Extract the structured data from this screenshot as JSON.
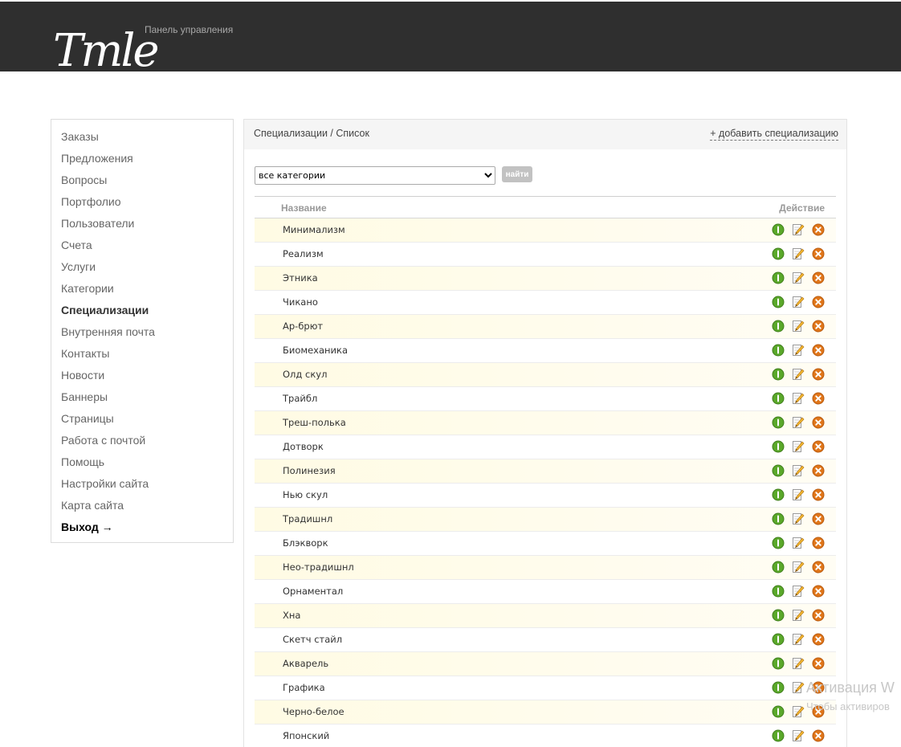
{
  "header": {
    "logo_text": "Tmle",
    "panel_label": "Панель управления"
  },
  "sidebar": {
    "items": [
      {
        "label": "Заказы",
        "state": "normal"
      },
      {
        "label": "Предложения",
        "state": "normal"
      },
      {
        "label": "Вопросы",
        "state": "normal"
      },
      {
        "label": "Портфолио",
        "state": "normal"
      },
      {
        "label": "Пользователи",
        "state": "normal"
      },
      {
        "label": "Счета",
        "state": "normal"
      },
      {
        "label": "Услуги",
        "state": "normal"
      },
      {
        "label": "Категории",
        "state": "normal"
      },
      {
        "label": "Специализации",
        "state": "active"
      },
      {
        "label": "Внутренняя почта",
        "state": "normal"
      },
      {
        "label": "Контакты",
        "state": "normal"
      },
      {
        "label": "Новости",
        "state": "normal"
      },
      {
        "label": "Баннеры",
        "state": "normal"
      },
      {
        "label": "Страницы",
        "state": "normal"
      },
      {
        "label": "Работа с почтой",
        "state": "normal"
      },
      {
        "label": "Помощь",
        "state": "normal"
      },
      {
        "label": "Настройки сайта",
        "state": "normal"
      },
      {
        "label": "Карта сайта",
        "state": "normal"
      },
      {
        "label": "Выход →",
        "state": "logout"
      }
    ]
  },
  "main": {
    "breadcrumb": "Специализации / Список",
    "add_link": "+ добавить специализацию",
    "filter": {
      "selected": "все категории",
      "button_label": "найти"
    },
    "table": {
      "columns": {
        "name": "Название",
        "action": "Действие"
      },
      "rows": [
        "Минимализм",
        "Реализм",
        "Этника",
        "Чикано",
        "Ар-брют",
        "Биомеханика",
        "Олд скул",
        "Трайбл",
        "Треш-полька",
        "Дотворк",
        "Полинезия",
        "Нью скул",
        "Традишнл",
        "Блэкворк",
        "Нео-традишнл",
        "Орнаментал",
        "Хна",
        "Скетч стайл",
        "Акварель",
        "Графика",
        "Черно-белое",
        "Японский"
      ]
    }
  },
  "icons": {
    "info": "info-icon",
    "edit": "edit-pencil-icon",
    "delete": "delete-x-icon"
  },
  "colors": {
    "topbar": "#2f2f2f",
    "info_green": "#5aa82a",
    "delete_orange": "#e0761a",
    "row_alt": "#fffbe4"
  },
  "watermark": {
    "line1": "Активация W",
    "line2": "Чтобы активиров"
  }
}
